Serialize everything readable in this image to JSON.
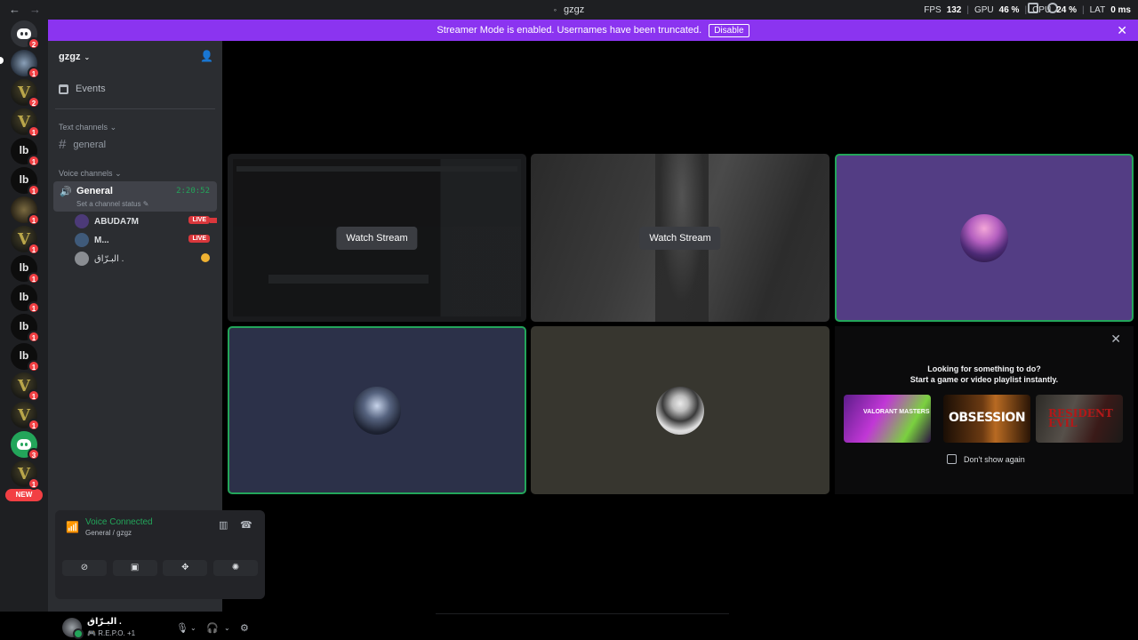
{
  "titlebar": {
    "title": "gzgz",
    "back": "←",
    "forward": "→",
    "stats": {
      "fps_label": "FPS",
      "fps": "132",
      "gpu_label": "GPU",
      "gpu": "46 %",
      "cpu_label": "CPU",
      "cpu": "24 %",
      "lat_label": "LAT",
      "lat": "0 ms"
    }
  },
  "banner": {
    "text": "Streamer Mode is enabled. Usernames have been truncated.",
    "disable_label": "Disable",
    "close": "✕"
  },
  "rail": {
    "new_badge": "NEW",
    "servers": [
      {
        "icon": "discord-home-icon",
        "badge": "2"
      },
      {
        "icon": "gear-server-icon",
        "badge": "1"
      },
      {
        "icon": "v-server-icon",
        "badge": "2"
      },
      {
        "icon": "v-server-icon",
        "badge": "1"
      },
      {
        "icon": "lb-server-icon",
        "badge": "1"
      },
      {
        "icon": "lb-server-icon",
        "badge": "1"
      },
      {
        "icon": "camo-server-icon",
        "badge": "1"
      },
      {
        "icon": "v-server-icon",
        "badge": "1"
      },
      {
        "icon": "lb-server-icon",
        "badge": "1"
      },
      {
        "icon": "lb-server-icon",
        "badge": "1"
      },
      {
        "icon": "lb-server-icon",
        "badge": "1"
      },
      {
        "icon": "lb-server-icon",
        "badge": "1"
      },
      {
        "icon": "v-server-icon",
        "badge": "1"
      },
      {
        "icon": "v-server-icon",
        "badge": "1"
      },
      {
        "icon": "discord-green-server-icon",
        "badge": "3"
      },
      {
        "icon": "v-server-icon",
        "badge": "1"
      }
    ]
  },
  "sidebar": {
    "guild_name": "gzgz",
    "events_label": "Events",
    "text_category": "Text channels",
    "text_channel": "general",
    "voice_category": "Voice channels",
    "voice_channel": {
      "name": "General",
      "timer": "2:20:52",
      "status_placeholder": "Set a channel status"
    },
    "members": [
      {
        "name": "ABUDA7M",
        "live": "LIVE",
        "avatar_color": "#4c3a78"
      },
      {
        "name": "M...",
        "live": "LIVE",
        "avatar_color": "#3f5a7a"
      },
      {
        "name": "البـرّاق .",
        "live": "",
        "avatar_color": "#8a8d92"
      }
    ]
  },
  "voice_panel": {
    "title": "Voice Connected",
    "subtitle": "General / gzgz",
    "buttons": [
      "camera-off-icon",
      "screen-share-icon",
      "activities-icon",
      "soundboard-icon"
    ]
  },
  "user": {
    "name": "البـرّاق .",
    "status": "R.E.P.O. +1"
  },
  "stage": {
    "watch_stream_1": "Watch Stream",
    "watch_stream_2": "Watch Stream"
  },
  "activity": {
    "line1": "Looking for something to do?",
    "line2": "Start a game or video playlist instantly.",
    "games": [
      {
        "title": "VALORANT MASTERS"
      },
      {
        "title": "OBSESSION"
      },
      {
        "title": "RESIDENT EVIL"
      }
    ],
    "dont_show": "Don't show again"
  },
  "colors": {
    "banner": "#8b34f0",
    "speaking_border": "#23a55a",
    "live_badge": "#da373c",
    "mention": "#f23f43"
  }
}
